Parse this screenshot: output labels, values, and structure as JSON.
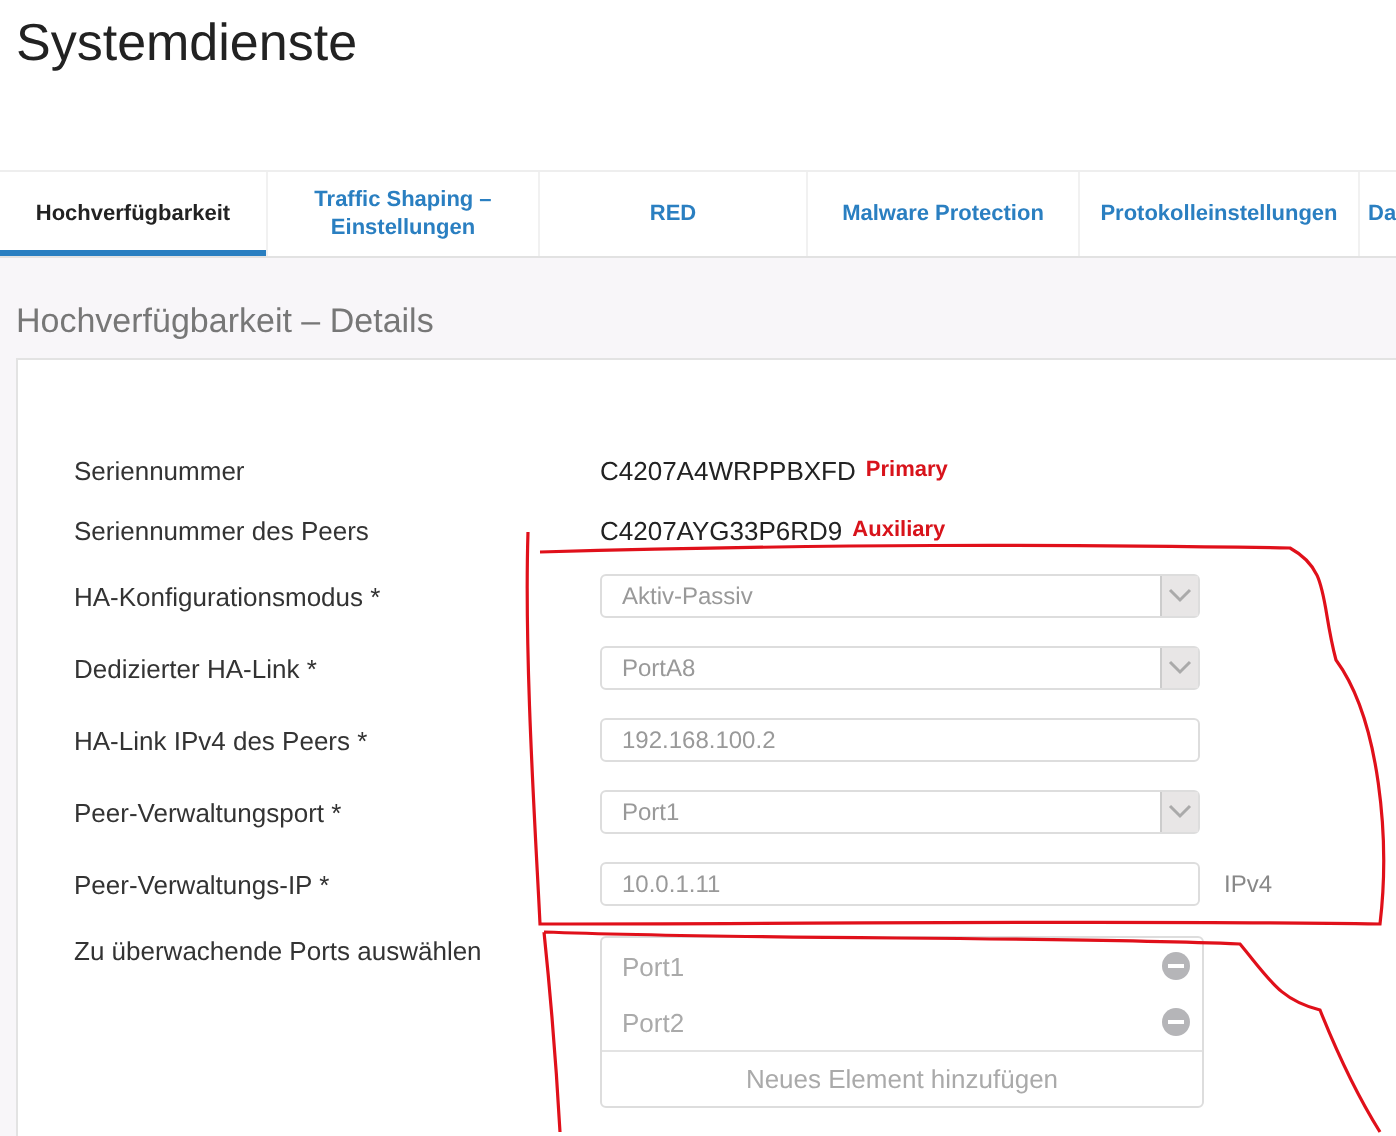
{
  "page_title": "Systemdienste",
  "tabs": [
    {
      "label": "Hochverfügbarkeit",
      "selected": true
    },
    {
      "label": "Traffic Shaping –\nEinstellungen",
      "selected": false
    },
    {
      "label": "RED",
      "selected": false
    },
    {
      "label": "Malware Protection",
      "selected": false
    },
    {
      "label": "Protokolleinstellungen",
      "selected": false
    },
    {
      "label": "Da",
      "selected": false
    }
  ],
  "section_title": "Hochverfügbarkeit – Details",
  "rows": [
    {
      "kind": "text",
      "label": "Seriennummer",
      "value": "C4207A4WRPPBXFD",
      "tag": "Primary"
    },
    {
      "kind": "text",
      "label": "Seriennummer des Peers",
      "value": "C4207AYG33P6RD9",
      "tag": "Auxiliary"
    },
    {
      "kind": "select",
      "label": "HA-Konfigurationsmodus *",
      "value": "Aktiv-Passiv"
    },
    {
      "kind": "select",
      "label": "Dedizierter HA-Link *",
      "value": "PortA8"
    },
    {
      "kind": "input",
      "label": "HA-Link IPv4 des Peers *",
      "value": "192.168.100.2"
    },
    {
      "kind": "select",
      "label": "Peer-Verwaltungsport *",
      "value": "Port1"
    },
    {
      "kind": "input",
      "label": "Peer-Verwaltungs-IP *",
      "value": "10.0.1.11",
      "suffix": "IPv4"
    }
  ],
  "ports": {
    "label": "Zu überwachende Ports auswählen",
    "items": [
      "Port1",
      "Port2"
    ],
    "add_button": "Neues Element hinzufügen"
  }
}
